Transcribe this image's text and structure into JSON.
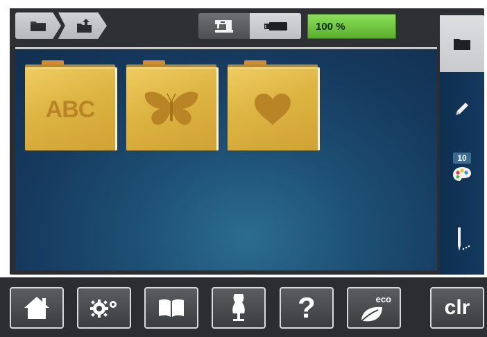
{
  "header": {
    "breadcrumb": [
      {
        "icon": "folder-icon"
      },
      {
        "icon": "folder-export-icon"
      }
    ],
    "mode_buttons": [
      {
        "icon": "sewing-machine-icon",
        "selected": true
      },
      {
        "icon": "usb-stick-icon",
        "selected": false
      }
    ],
    "memory": {
      "label": "100 %",
      "level": 1.0,
      "color": "#6cc83c"
    }
  },
  "folders": [
    {
      "label": "ABC",
      "icon": "text-icon"
    },
    {
      "label": "",
      "icon": "butterfly-icon"
    },
    {
      "label": "",
      "icon": "heart-icon"
    }
  ],
  "sidebar": {
    "top_tab_icon": "folder-icon",
    "items": [
      {
        "icon": "pencil-icon"
      },
      {
        "icon": "color-palette-icon",
        "count": "10"
      },
      {
        "icon": "needle-icon"
      }
    ]
  },
  "bottom_bar": [
    {
      "icon": "home-icon"
    },
    {
      "icon": "settings-icon"
    },
    {
      "icon": "book-icon"
    },
    {
      "icon": "dress-form-icon"
    },
    {
      "icon": "help-icon",
      "label": "?"
    },
    {
      "icon": "eco-leaf-icon",
      "label": "eco"
    },
    {
      "icon": "clear-icon",
      "label": "clr"
    }
  ],
  "colors": {
    "accent": "#6cc83c",
    "folder": "#ddb442",
    "panel": "#1d4f74"
  }
}
